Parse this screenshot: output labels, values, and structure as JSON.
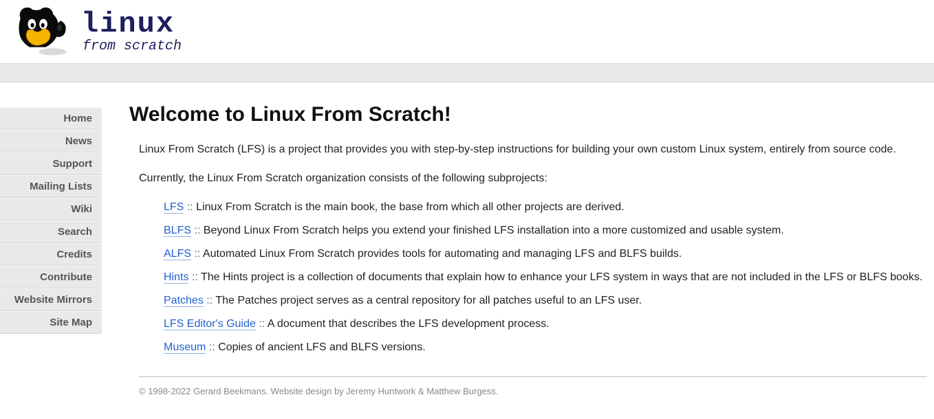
{
  "logo": {
    "title": "linux",
    "subtitle": "from scratch"
  },
  "nav": [
    {
      "label": "Home"
    },
    {
      "label": "News"
    },
    {
      "label": "Support"
    },
    {
      "label": "Mailing Lists"
    },
    {
      "label": "Wiki"
    },
    {
      "label": "Search"
    },
    {
      "label": "Credits"
    },
    {
      "label": "Contribute"
    },
    {
      "label": "Website Mirrors"
    },
    {
      "label": "Site Map"
    }
  ],
  "main": {
    "heading": "Welcome to Linux From Scratch!",
    "intro1": "Linux From Scratch (LFS) is a project that provides you with step-by-step instructions for building your own custom Linux system, entirely from source code.",
    "intro2": "Currently, the Linux From Scratch organization consists of the following subprojects:",
    "projects": [
      {
        "link": "LFS",
        "desc": "Linux From Scratch is the main book, the base from which all other projects are derived."
      },
      {
        "link": "BLFS",
        "desc": "Beyond Linux From Scratch helps you extend your finished LFS installation into a more customized and usable system."
      },
      {
        "link": "ALFS",
        "desc": "Automated Linux From Scratch provides tools for automating and managing LFS and BLFS builds."
      },
      {
        "link": "Hints",
        "desc": "The Hints project is a collection of documents that explain how to enhance your LFS system in ways that are not included in the LFS or BLFS books."
      },
      {
        "link": "Patches",
        "desc": "The Patches project serves as a central repository for all patches useful to an LFS user."
      },
      {
        "link": "LFS Editor's Guide",
        "desc": "A document that describes the LFS development process."
      },
      {
        "link": "Museum",
        "desc": "Copies of ancient LFS and BLFS versions."
      }
    ],
    "sep": " :: "
  },
  "footer": {
    "prefix": "© 1998-2022 Gerard Beekmans. Website design by ",
    "link1": "Jeremy Huntwork",
    "amp": " & ",
    "link2": "Matthew Burgess",
    "suffix": "."
  }
}
